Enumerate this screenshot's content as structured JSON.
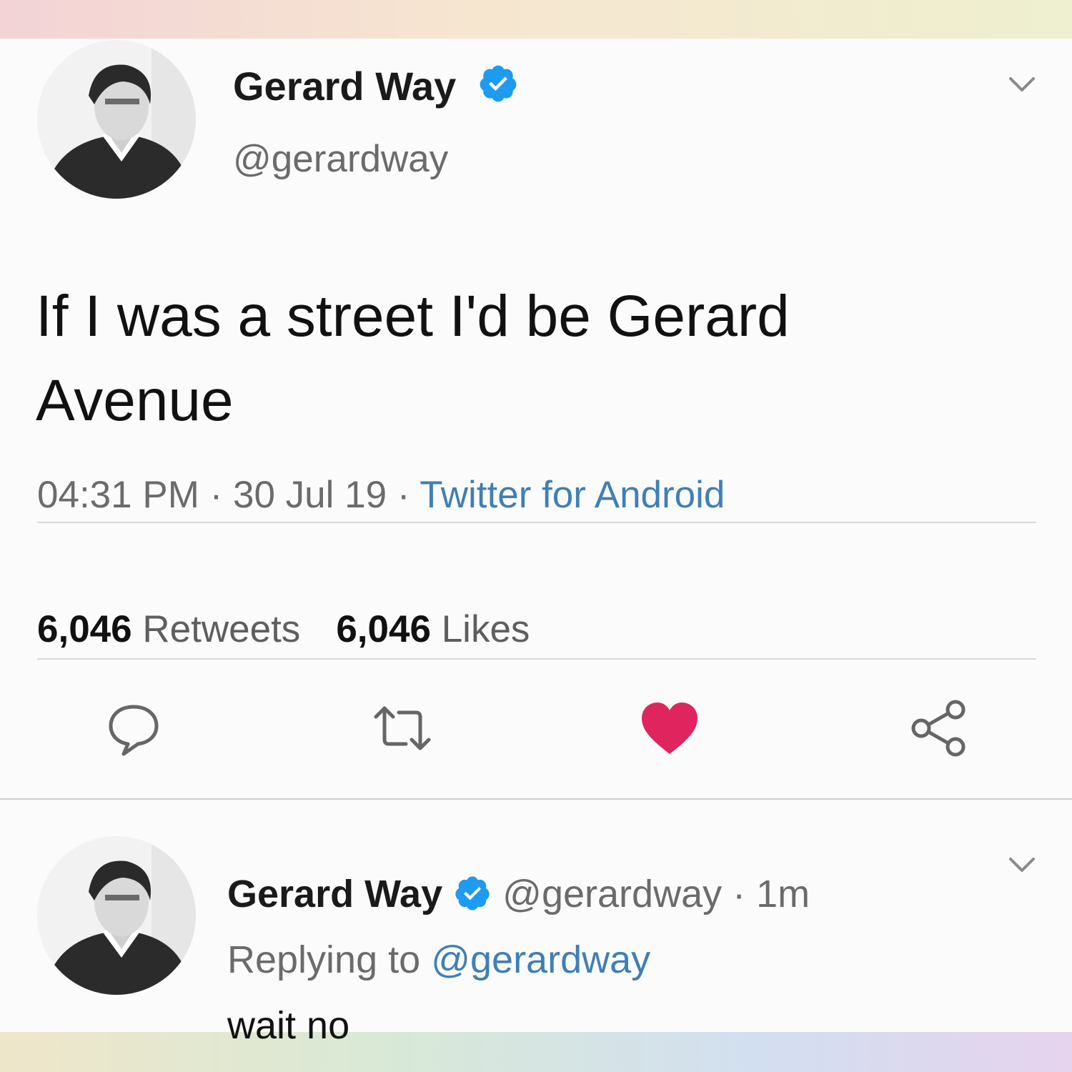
{
  "tweet": {
    "author_name": "Gerard Way",
    "author_handle": "@gerardway",
    "verified": true,
    "text": "If I was a street I'd be Gerard Avenue",
    "time": "04:31 PM",
    "date": "30 Jul 19",
    "source": "Twitter for Android",
    "separator": "·",
    "retweet_count": "6,046",
    "retweet_label": "Retweets",
    "like_count": "6,046",
    "like_label": "Likes",
    "liked": true
  },
  "reply": {
    "author_name": "Gerard Way",
    "author_handle": "@gerardway",
    "age": "1m",
    "replying_to_label": "Replying to",
    "replying_to_handle": "@gerardway",
    "text": "wait no"
  },
  "icons": {
    "verified": "verified-badge-icon",
    "menu": "chevron-down-icon",
    "reply": "comment-icon",
    "retweet": "retweet-icon",
    "like": "heart-icon",
    "share": "share-icon"
  },
  "colors": {
    "verified_blue": "#1d9bf0",
    "link_blue": "#3f7fb5",
    "like_red": "#e0245e",
    "muted_text": "#6b6b6b"
  }
}
